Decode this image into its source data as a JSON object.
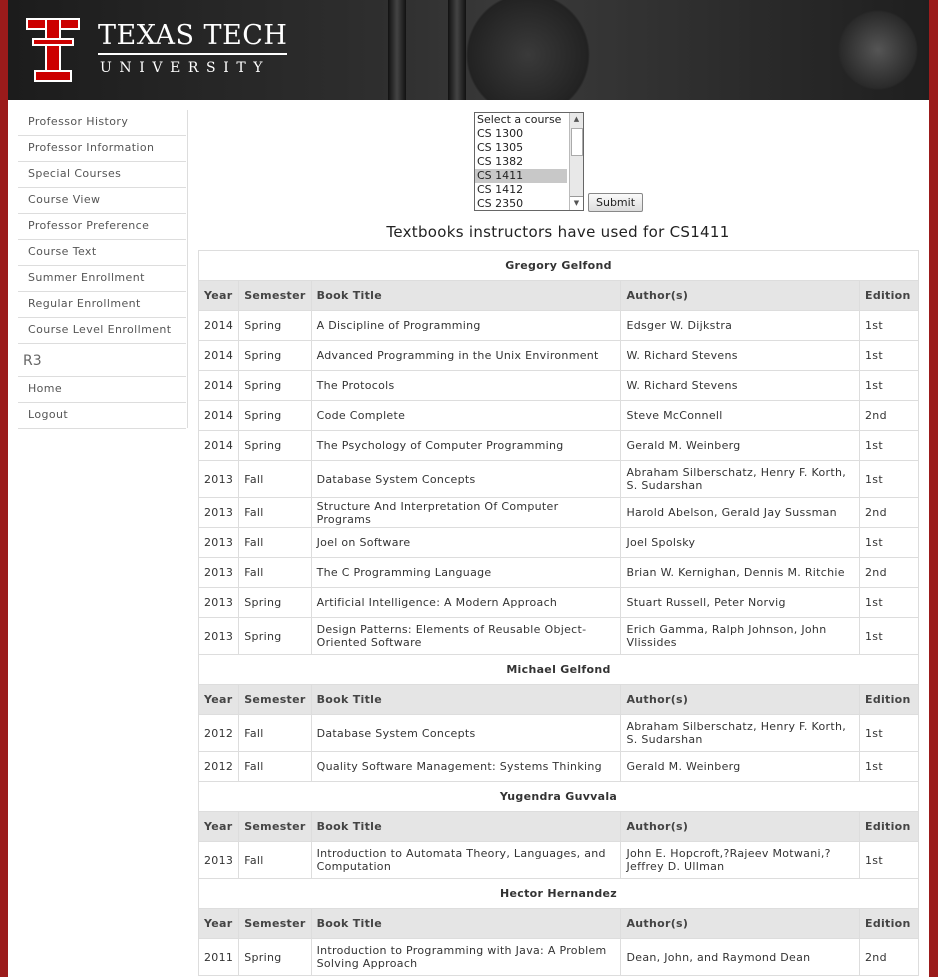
{
  "header": {
    "brand_line1": "TEXAS TECH",
    "brand_line2": "UNIVERSITY",
    "logo_icon": "double-t-logo-icon",
    "accent_red": "#cc0000"
  },
  "nav": {
    "items": [
      "Professor History",
      "Professor Information",
      "Special Courses",
      "Course View",
      "Professor Preference",
      "Course Text",
      "Summer Enrollment",
      "Regular Enrollment",
      "Course Level Enrollment"
    ],
    "section": "R3",
    "footer_items": [
      "Home",
      "Logout"
    ]
  },
  "course_select": {
    "options": [
      "Select a course",
      "CS 1300",
      "CS 1305",
      "CS 1382",
      "CS 1411",
      "CS 1412",
      "CS 2350"
    ],
    "selected": "CS 1411"
  },
  "submit_label": "Submit",
  "page_title": "Textbooks instructors have used for CS1411",
  "columns": [
    "Year",
    "Semester",
    "Book Title",
    "Author(s)",
    "Edition"
  ],
  "groups": [
    {
      "professor": "Gregory Gelfond",
      "rows": [
        [
          "2014",
          "Spring",
          "A Discipline of Programming",
          "Edsger W. Dijkstra",
          "1st"
        ],
        [
          "2014",
          "Spring",
          "Advanced Programming in the Unix Environment",
          "W. Richard Stevens",
          "1st"
        ],
        [
          "2014",
          "Spring",
          "The Protocols",
          "W. Richard Stevens",
          "1st"
        ],
        [
          "2014",
          "Spring",
          "Code Complete",
          "Steve McConnell",
          "2nd"
        ],
        [
          "2014",
          "Spring",
          "The Psychology of Computer Programming",
          "Gerald M. Weinberg",
          "1st"
        ],
        [
          "2013",
          "Fall",
          "Database System Concepts",
          "Abraham Silberschatz, Henry F. Korth, S. Sudarshan",
          "1st"
        ],
        [
          "2013",
          "Fall",
          "Structure And Interpretation Of Computer Programs",
          "Harold Abelson, Gerald Jay Sussman",
          "2nd"
        ],
        [
          "2013",
          "Fall",
          "Joel on Software",
          "Joel Spolsky",
          "1st"
        ],
        [
          "2013",
          "Fall",
          "The C Programming Language",
          "Brian W. Kernighan, Dennis M. Ritchie",
          "2nd"
        ],
        [
          "2013",
          "Spring",
          "Artificial Intelligence: A Modern Approach",
          "Stuart Russell, Peter Norvig",
          "1st"
        ],
        [
          "2013",
          "Spring",
          "Design Patterns: Elements of Reusable Object-Oriented Software",
          "Erich Gamma, Ralph Johnson, John Vlissides",
          "1st"
        ]
      ]
    },
    {
      "professor": "Michael Gelfond",
      "rows": [
        [
          "2012",
          "Fall",
          "Database System Concepts",
          "Abraham Silberschatz, Henry F. Korth, S. Sudarshan",
          "1st"
        ],
        [
          "2012",
          "Fall",
          "Quality Software Management: Systems Thinking",
          "Gerald M. Weinberg",
          "1st"
        ]
      ]
    },
    {
      "professor": "Yugendra Guvvala",
      "rows": [
        [
          "2013",
          "Fall",
          "Introduction to Automata Theory, Languages, and Computation",
          "John E. Hopcroft,?Rajeev Motwani,? Jeffrey D. Ullman",
          "1st"
        ]
      ]
    },
    {
      "professor": "Hector Hernandez",
      "rows": [
        [
          "2011",
          "Spring",
          "Introduction to Programming with Java: A Problem Solving Approach",
          "Dean, John, and Raymond Dean",
          "2nd"
        ]
      ]
    }
  ]
}
